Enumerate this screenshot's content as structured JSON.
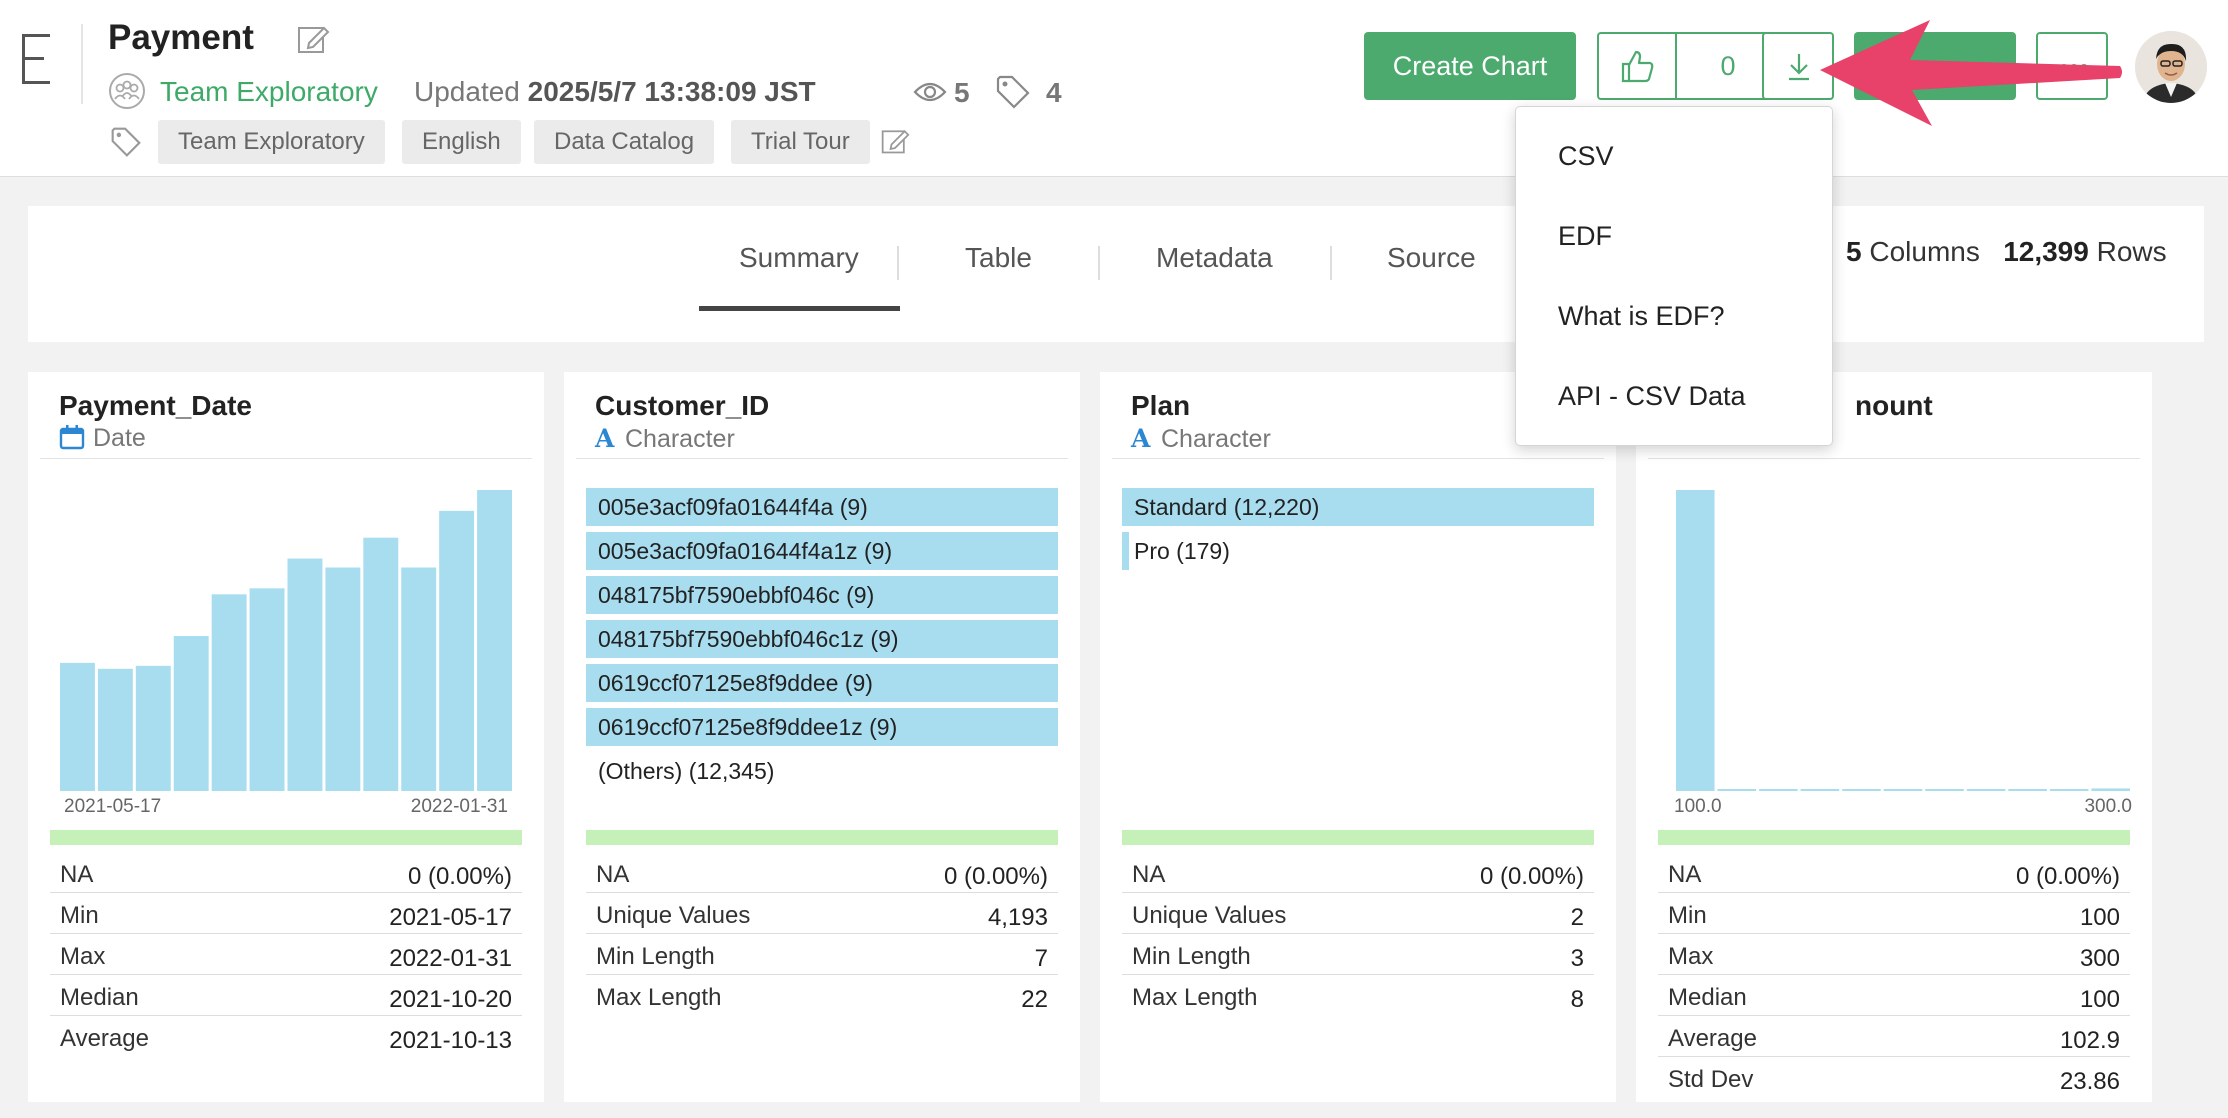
{
  "header": {
    "title": "Payment",
    "team": "Team Exploratory",
    "updated_prefix": "Updated",
    "updated_value": "2025/5/7 13:38:09 JST",
    "views": "5",
    "tags_count": "4",
    "tags": [
      "Team Exploratory",
      "English",
      "Data Catalog",
      "Trial Tour"
    ],
    "create_chart_label": "Create Chart",
    "like_count": "0"
  },
  "tabs": [
    "Summary",
    "Table",
    "Metadata",
    "Source"
  ],
  "active_tab": "Summary",
  "counts": {
    "columns_value": "5",
    "columns_label": "Columns",
    "rows_value": "12,399",
    "rows_label": "Rows"
  },
  "download_menu": [
    "CSV",
    "EDF",
    "What is EDF?",
    "API - CSV Data"
  ],
  "colors": {
    "accent": "#4caa6e",
    "bar": "#a8ddf0",
    "summary_bar": "#c5f0b8",
    "arrow": "#e8416a"
  },
  "columns": [
    {
      "name": "Payment_Date",
      "type": "Date",
      "type_icon": "calendar-icon",
      "chart_data": {
        "type": "bar",
        "x_range": [
          "2021-05-17",
          "2022-01-31"
        ],
        "values": [
          43,
          41,
          42,
          52,
          66,
          68,
          78,
          75,
          85,
          75,
          94,
          101
        ],
        "ylim": [
          0,
          101
        ]
      },
      "x_min_label": "2021-05-17",
      "x_max_label": "2022-01-31",
      "stats": [
        {
          "label": "NA",
          "value": "0 (0.00%)"
        },
        {
          "label": "Min",
          "value": "2021-05-17"
        },
        {
          "label": "Max",
          "value": "2022-01-31"
        },
        {
          "label": "Median",
          "value": "2021-10-20"
        },
        {
          "label": "Average",
          "value": "2021-10-13"
        }
      ]
    },
    {
      "name": "Customer_ID",
      "type": "Character",
      "type_icon": "character-icon",
      "categories": [
        {
          "label": "005e3acf09fa01644f4a (9)",
          "fraction": 1.0
        },
        {
          "label": "005e3acf09fa01644f4a1z (9)",
          "fraction": 1.0
        },
        {
          "label": "048175bf7590ebbf046c (9)",
          "fraction": 1.0
        },
        {
          "label": "048175bf7590ebbf046c1z (9)",
          "fraction": 1.0
        },
        {
          "label": "0619ccf07125e8f9ddee (9)",
          "fraction": 1.0
        },
        {
          "label": "0619ccf07125e8f9ddee1z (9)",
          "fraction": 1.0
        },
        {
          "label": "(Others) (12,345)",
          "fraction": 0
        }
      ],
      "stats": [
        {
          "label": "NA",
          "value": "0 (0.00%)"
        },
        {
          "label": "Unique Values",
          "value": "4,193"
        },
        {
          "label": "Min Length",
          "value": "7"
        },
        {
          "label": "Max Length",
          "value": "22"
        }
      ]
    },
    {
      "name": "Plan",
      "type": "Character",
      "type_icon": "character-icon",
      "categories": [
        {
          "label": "Standard (12,220)",
          "fraction": 1.0
        },
        {
          "label": "Pro (179)",
          "fraction": 0.0146
        }
      ],
      "stats": [
        {
          "label": "NA",
          "value": "0 (0.00%)"
        },
        {
          "label": "Unique Values",
          "value": "2"
        },
        {
          "label": "Min Length",
          "value": "3"
        },
        {
          "label": "Max Length",
          "value": "8"
        }
      ]
    },
    {
      "name_visible_fragment": "nount",
      "chart_data": {
        "type": "bar",
        "x_range": [
          100.0,
          300.0
        ],
        "values": [
          12220,
          18,
          18,
          18,
          18,
          18,
          18,
          18,
          18,
          18,
          104
        ],
        "ylim": [
          0,
          12220
        ]
      },
      "x_min_label": "100.0",
      "x_max_label": "300.0",
      "stats": [
        {
          "label": "NA",
          "value": "0 (0.00%)"
        },
        {
          "label": "Min",
          "value": "100"
        },
        {
          "label": "Max",
          "value": "300"
        },
        {
          "label": "Median",
          "value": "100"
        },
        {
          "label": "Average",
          "value": "102.9"
        },
        {
          "label": "Std Dev",
          "value": "23.86"
        }
      ]
    }
  ]
}
